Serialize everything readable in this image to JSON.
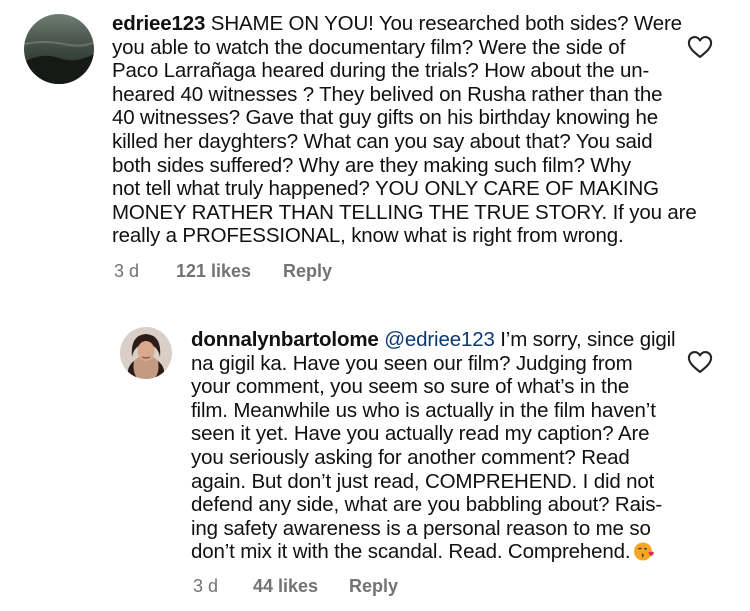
{
  "comments": [
    {
      "avatar_icon": "avatar-landscape-photo",
      "username": "edriee123",
      "lines": [
        " SHAME ON YOU! You researched both sides? Were",
        "you able to watch the documentary film? Were the side of",
        "Paco Larrañaga heared during the trials? How about the un-",
        "heared 40 witnesses ? They belived on Rusha rather than the",
        "40 witnesses? Gave that guy gifts on his birthday knowing he",
        "killed her dayghters? What can you say about that? You said",
        "both sides suffered? Why are they making such film? Why",
        "not tell what truly happened? YOU ONLY CARE OF MAKING",
        "MONEY RATHER THAN TELLING THE TRUE STORY. If you are",
        "really a PROFESSIONAL, know what is right from wrong."
      ],
      "time": "3 d",
      "likes": "121 likes",
      "reply": "Reply",
      "like_icon": "heart-outline-icon"
    },
    {
      "avatar_icon": "avatar-profile-photo",
      "username": "donnalynbartolome",
      "mention": "@edriee123",
      "lines": [
        " I’m sorry, since gigil",
        "na gigil ka. Have you seen our film? Judging from",
        "your comment, you seem so sure of what’s in the",
        "film. Meanwhile us who is actually in the film haven’t",
        "seen it yet. Have you actually read my caption? Are",
        "you seriously asking for another comment? Read",
        "again. But don’t just read, COMPREHEND. I did not",
        "defend any side, what are you babbling about? Rais-",
        "ing safety awareness is a personal reason to me so",
        "don’t mix it with the scandal. Read. Comprehend."
      ],
      "emoji": "face-blowing-a-kiss-emoji",
      "time": "3 d",
      "likes": "44 likes",
      "reply": "Reply",
      "like_icon": "heart-outline-icon"
    }
  ],
  "colors": {
    "text": "#111111",
    "meta": "#737373",
    "mention": "#0b3a73",
    "emoji": "#f5a623",
    "kiss_heart": "#e0245e"
  }
}
